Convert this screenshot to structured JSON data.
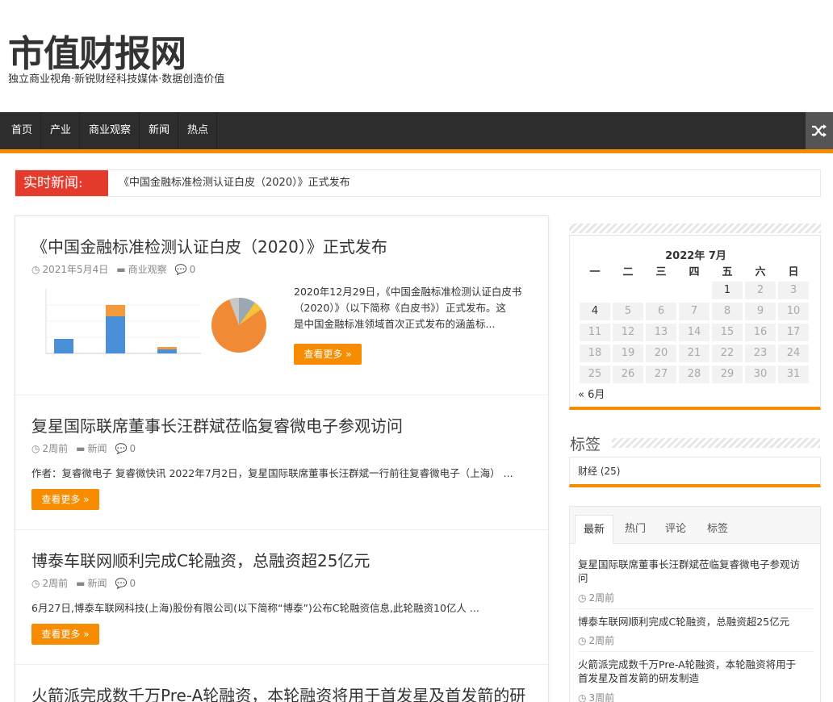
{
  "site": {
    "title": "市值财报网",
    "description": "独立商业视角·新锐财经科技媒体·数据创造价值"
  },
  "nav": {
    "items": [
      "首页",
      "产业",
      "商业观察",
      "新闻",
      "热点"
    ]
  },
  "breaking": {
    "label": "实时新闻:",
    "text": "《中国金融标准检测认证白皮（2020）》正式发布"
  },
  "posts": [
    {
      "title": "《中国金融标准检测认证白皮（2020）》正式发布",
      "date": "2021年5月4日",
      "category": "商业观察",
      "comments": "0",
      "excerpt_lines": [
        "2020年12月29日，《中国金融标准检测认证白皮书",
        "（2020）》（以下简称《白皮书》）正式发布。这",
        "是中国金融标准领域首次正式发布的涵盖标..."
      ],
      "more": "查看更多 »"
    },
    {
      "title": "复星国际联席董事长汪群斌莅临复睿微电子参观访问",
      "date": "2周前",
      "category": "新闻",
      "comments": "0",
      "excerpt": "作者：复睿微电子 复睿微快讯 2022年7月2日，复星国际联席董事长汪群斌一行前往复睿微电子（上海） ...",
      "more": "查看更多 »"
    },
    {
      "title": "博泰车联网顺利完成C轮融资，总融资超25亿元",
      "date": "2周前",
      "category": "新闻",
      "comments": "0",
      "excerpt": "6月27日,博泰车联网科技(上海)股份有限公司(以下简称“博泰”)公布C轮融资信息,此轮融资10亿人 ...",
      "more": "查看更多 »"
    },
    {
      "title": "火箭派完成数千万Pre-A轮融资，本轮融资将用于首发星及首发箭的研"
    }
  ],
  "calendar": {
    "caption": "2022年 7月",
    "weekdays": [
      "一",
      "二",
      "三",
      "四",
      "五",
      "六",
      "日"
    ],
    "days": [
      "1",
      "2",
      "3",
      "4",
      "5",
      "6",
      "7",
      "8",
      "9",
      "10",
      "11",
      "12",
      "13",
      "14",
      "15",
      "16",
      "17",
      "18",
      "19",
      "20",
      "21",
      "22",
      "23",
      "24",
      "25",
      "26",
      "27",
      "28",
      "29",
      "30",
      "31"
    ],
    "prev": "« 6月"
  },
  "tags": {
    "title": "标签",
    "item": "财经 (25)"
  },
  "tabs": {
    "labels": [
      "最新",
      "热门",
      "评论",
      "标签"
    ],
    "recent": [
      {
        "lines": [
          "复星国际联席董事长汪群斌莅临复睿微电子参观访",
          "问"
        ],
        "time": "2周前"
      },
      {
        "lines": [
          "博泰车联网顺利完成C轮融资，总融资超25亿元"
        ],
        "time": "2周前"
      },
      {
        "lines": [
          "火箭派完成数千万Pre-A轮融资，本轮融资将用于",
          "首发星及首发箭的研发制造"
        ],
        "time": "3周前"
      }
    ]
  },
  "colors": {
    "accent": "#f88c00",
    "breaking": "#e53b2c",
    "nav_bg": "#2d2d2d"
  }
}
